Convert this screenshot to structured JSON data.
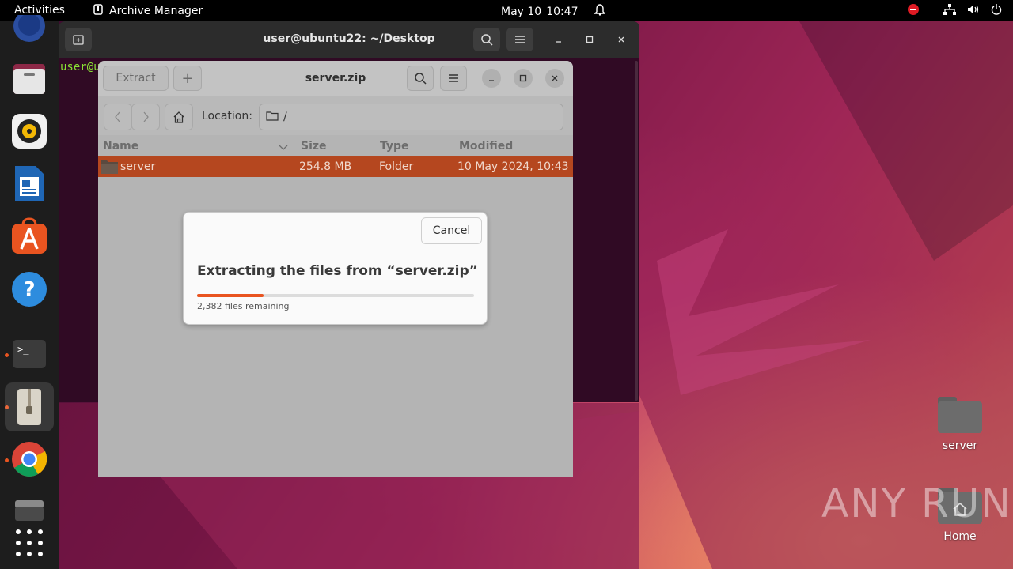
{
  "topbar": {
    "activities": "Activities",
    "app_name": "Archive Manager",
    "date": "May 10",
    "time": "10:47"
  },
  "terminal": {
    "title": "user@ubuntu22: ~/Desktop",
    "prompt_fragment": "user@u"
  },
  "archive": {
    "title": "server.zip",
    "extract_label": "Extract",
    "add_label": "+",
    "location_label": "Location:",
    "location_path": "/",
    "columns": {
      "name": "Name",
      "size": "Size",
      "type": "Type",
      "modified": "Modified"
    },
    "rows": [
      {
        "name": "server",
        "size": "254.8 MB",
        "type": "Folder",
        "modified": "10 May 2024, 10:43"
      }
    ]
  },
  "dialog": {
    "cancel_label": "Cancel",
    "title": "Extracting the files from “server.zip”",
    "progress_fraction": 0.24,
    "remaining": "2,382 files remaining"
  },
  "desktop": {
    "icons": [
      {
        "label": "server"
      },
      {
        "label": "Home"
      }
    ]
  },
  "watermark": "ANY RUN",
  "colors": {
    "accent": "#e95420",
    "selection": "#b5471f"
  }
}
